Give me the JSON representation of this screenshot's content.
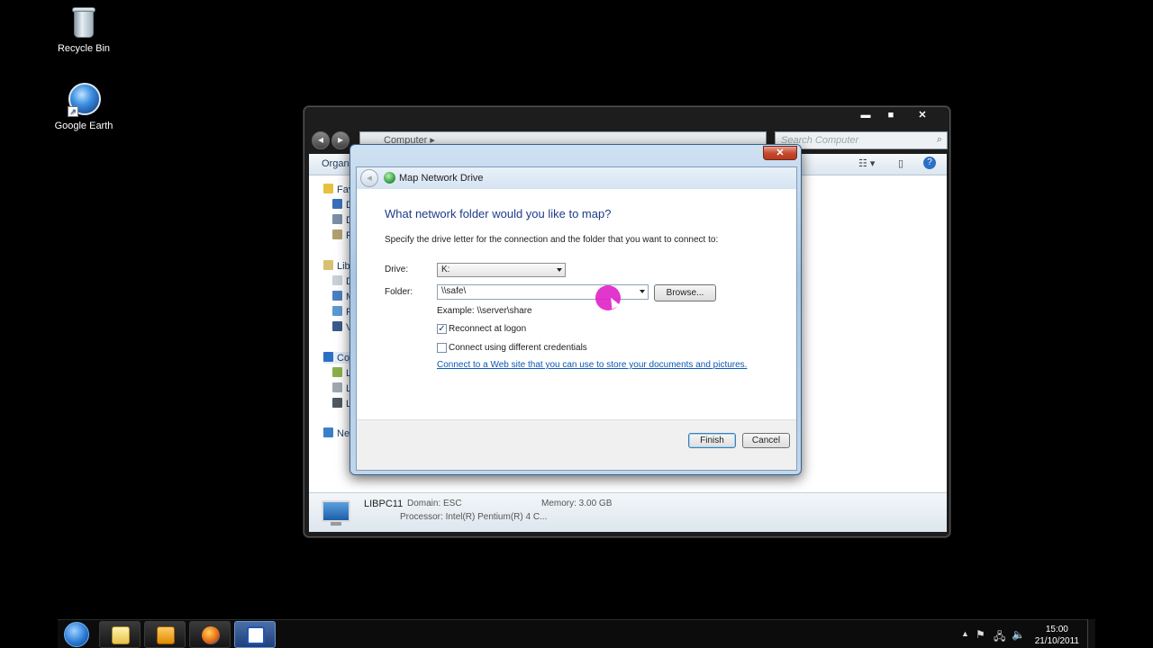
{
  "desktop": {
    "icons": [
      {
        "label": "Recycle Bin",
        "icon": "recycle-bin-icon"
      },
      {
        "label": "Google Earth",
        "icon": "google-earth-icon"
      }
    ]
  },
  "explorer": {
    "breadcrumb": "Computer",
    "search_placeholder": "Search Computer",
    "toolbar_organize": "Organiz",
    "nav_pane": {
      "favorites": "Fav",
      "fav_items": [
        "D",
        "D",
        "R"
      ],
      "libraries": "Libr",
      "lib_items": [
        "D",
        "M",
        "P",
        "V"
      ],
      "computer": "Co",
      "comp_items": [
        "L",
        "L",
        "L"
      ],
      "network": "Net"
    },
    "details": {
      "pc_name": "LIBPC11",
      "domain": "Domain:  ESC",
      "memory": "Memory:  3.00 GB",
      "processor": "Processor:  Intel(R) Pentium(R) 4 C..."
    }
  },
  "dialog": {
    "title": "Map Network Drive",
    "close": "✕",
    "heading": "What network folder would you like to map?",
    "instruction": "Specify the drive letter for the connection and the folder that you want to connect to:",
    "drive_label": "Drive:",
    "drive_value": "K:",
    "folder_label": "Folder:",
    "folder_value": "\\\\safe\\",
    "browse_label": "Browse...",
    "example": "Example: \\\\server\\share",
    "reconnect_label": "Reconnect at logon",
    "reconnect_checked": true,
    "credentials_label": "Connect using different credentials",
    "credentials_checked": false,
    "web_link": "Connect to a Web site that you can use to store your documents and pictures.",
    "finish_label": "Finish",
    "cancel_label": "Cancel"
  },
  "taskbar": {
    "buttons": [
      "start-orb",
      "windows-explorer-icon",
      "media-player-icon",
      "firefox-icon",
      "remote-desktop-icon"
    ],
    "time": "15:00",
    "date": "21/10/2011"
  }
}
